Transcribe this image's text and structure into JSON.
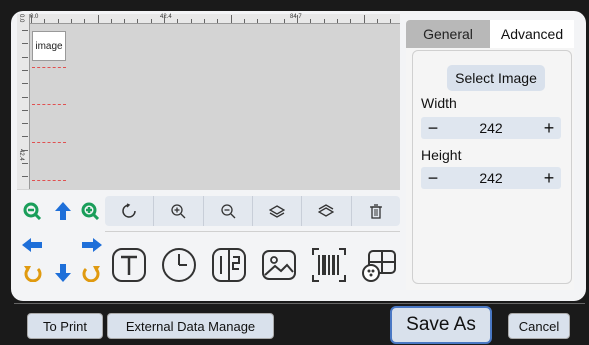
{
  "ruler": {
    "top_labels": [
      "0.0",
      "42.4",
      "84.7"
    ],
    "left_label": "42.4",
    "origin_label": "0.0"
  },
  "canvas": {
    "image_label": "image"
  },
  "colors": {
    "zoom": "#1a9e5a",
    "arrows": "#1e6fd9",
    "rotate": "#e09a10",
    "accent": "#4a78c4"
  },
  "arrows": {
    "zoom_out": "zoom-out-icon",
    "up": "arrow-up-icon",
    "zoom_in": "zoom-in-icon",
    "left": "arrow-left-icon",
    "right": "arrow-right-icon",
    "rot_ccw": "rotate-ccw-icon",
    "down": "arrow-down-icon",
    "rot_cw": "rotate-cw-icon"
  },
  "toolbar": [
    "rotate-icon",
    "zoom-in-icon",
    "zoom-out-icon",
    "layer-up-icon",
    "layer-down-icon",
    "trash-icon"
  ],
  "tools": [
    "text-tool-icon",
    "clock-tool-icon",
    "serial-number-tool-icon",
    "image-tool-icon",
    "barcode-tool-icon",
    "table-tool-icon"
  ],
  "side": {
    "tab_general": "General",
    "tab_advanced": "Advanced",
    "select_image": "Select Image",
    "width_label": "Width",
    "width_value": "242",
    "height_label": "Height",
    "height_value": "242",
    "minus": "−",
    "plus": "+"
  },
  "bottom": {
    "to_print": "To Print",
    "external_data": "External Data Manage",
    "save_as": "Save As",
    "cancel": "Cancel"
  }
}
